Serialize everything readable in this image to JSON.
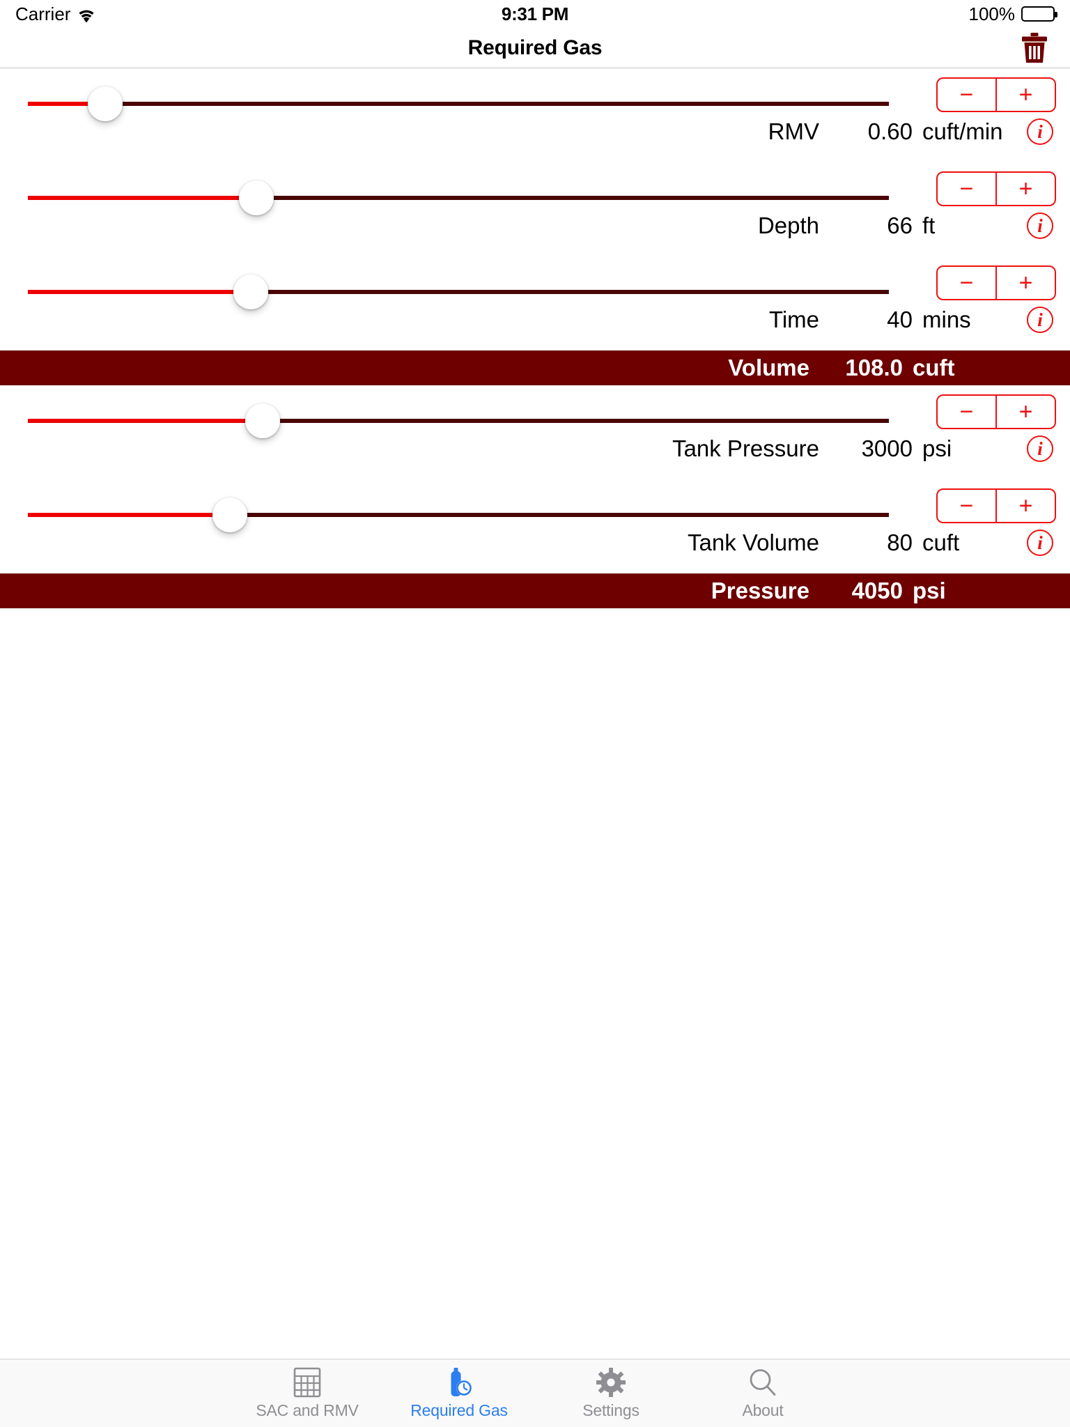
{
  "status_bar": {
    "carrier": "Carrier",
    "wifi_icon": "wifi-icon",
    "time": "9:31 PM",
    "battery_percent": "100%",
    "battery_icon": "battery-full-icon"
  },
  "nav_bar": {
    "title": "Required Gas",
    "trash_icon": "trash-icon",
    "trash_color": "#6e0000"
  },
  "theme": {
    "track_active": "#ee0000",
    "track_inactive": "#4a0606",
    "control_red": "#ee1111",
    "result_bar_bg": "#6e0000",
    "tab_active": "#2b7ef0",
    "tab_inactive": "#8e8e93"
  },
  "stepper": {
    "minus_label": "−",
    "plus_label": "+"
  },
  "info_label": "i",
  "rows": [
    {
      "name": "RMV",
      "value": "0.60",
      "unit": "cuft/min",
      "slider_percent": 9.0
    },
    {
      "name": "Depth",
      "value": "66",
      "unit": "ft",
      "slider_percent": 26.5
    },
    {
      "name": "Time",
      "value": "40",
      "unit": "mins",
      "slider_percent": 25.9
    },
    {
      "name": "Tank Pressure",
      "value": "3000",
      "unit": "psi",
      "slider_percent": 27.3
    },
    {
      "name": "Tank Volume",
      "value": "80",
      "unit": "cuft",
      "slider_percent": 23.5
    }
  ],
  "results": [
    {
      "name": "Volume",
      "value": "108.0",
      "unit": "cuft"
    },
    {
      "name": "Pressure",
      "value": "4050",
      "unit": "psi"
    }
  ],
  "tab_bar": {
    "items": [
      {
        "label": "SAC and RMV",
        "icon": "calculator-grid-icon",
        "active": false
      },
      {
        "label": "Required Gas",
        "icon": "scuba-tank-icon",
        "active": true
      },
      {
        "label": "Settings",
        "icon": "gear-icon",
        "active": false
      },
      {
        "label": "About",
        "icon": "magnifier-icon",
        "active": false
      }
    ]
  }
}
